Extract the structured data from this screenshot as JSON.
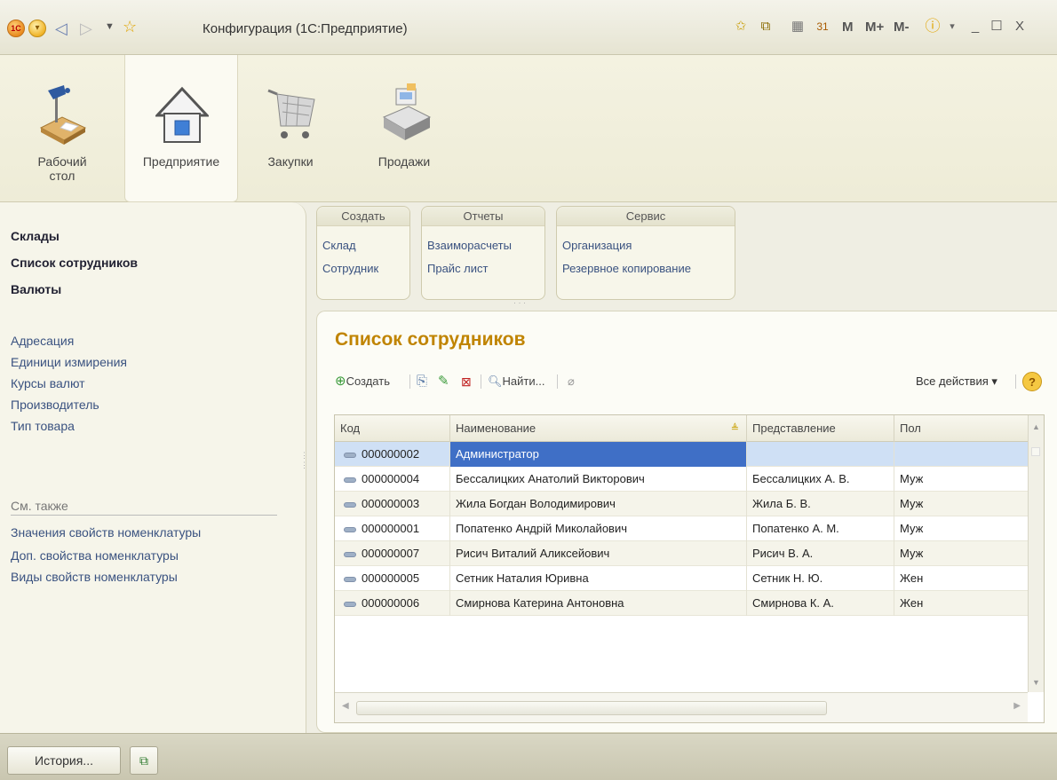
{
  "window": {
    "title": "Конфигурация  (1С:Предприятие)",
    "logo": "1C",
    "calc_buttons": [
      "M",
      "M+",
      "M-"
    ],
    "window_controls": [
      "_",
      "☐",
      "X"
    ]
  },
  "sections": [
    {
      "label_line1": "Рабочий",
      "label_line2": "стол",
      "icon": "desk-lamp-icon"
    },
    {
      "label_line1": "Предприятие",
      "label_line2": "",
      "icon": "house-icon",
      "active": true
    },
    {
      "label_line1": "Закупки",
      "label_line2": "",
      "icon": "shopping-cart-icon"
    },
    {
      "label_line1": "Продажи",
      "label_line2": "",
      "icon": "cash-register-icon"
    }
  ],
  "leftnav": {
    "main_items": [
      "Склады",
      "Список сотрудников",
      "Валюты"
    ],
    "items": [
      "Адресация",
      "Единици измирения",
      "Курсы валют",
      "Производитель",
      "Тип товара"
    ],
    "see_also_label": "См. также",
    "see_also_items": [
      "Значения свойств номенклатуры",
      "Доп. свойства номенклатуры",
      "Виды свойств номенклатуры"
    ]
  },
  "actions": {
    "create": {
      "header": "Создать",
      "items": [
        "Склад",
        "Сотрудник"
      ]
    },
    "reports": {
      "header": "Отчеты",
      "items": [
        "Взаиморасчеты",
        "Прайс лист"
      ]
    },
    "service": {
      "header": "Сервис",
      "items": [
        "Организация",
        "Резервное копирование"
      ]
    }
  },
  "form": {
    "title": "Список сотрудников",
    "toolbar": {
      "create_label": "Создать",
      "find_label": "Найти...",
      "all_actions_label": "Все действия ▾",
      "help_label": "?"
    },
    "columns": [
      "Код",
      "Наименование",
      "Представление",
      "Пол"
    ],
    "rows": [
      {
        "code": "000000002",
        "name": "Администратор",
        "short": "",
        "gender": ""
      },
      {
        "code": "000000004",
        "name": "Бессалицких Анатолий Викторович",
        "short": "Бессалицких А. В.",
        "gender": "Муж"
      },
      {
        "code": "000000003",
        "name": "Жила Богдан Володимирович",
        "short": "Жила Б. В.",
        "gender": "Муж"
      },
      {
        "code": "000000001",
        "name": "Попатенко Андрій Миколайович",
        "short": "Попатенко А. М.",
        "gender": "Муж"
      },
      {
        "code": "000000007",
        "name": "Рисич Виталий Аликсейович",
        "short": "Рисич В. А.",
        "gender": "Муж"
      },
      {
        "code": "000000005",
        "name": "Сетник Наталия Юривна",
        "short": "Сетник Н. Ю.",
        "gender": "Жен"
      },
      {
        "code": "000000006",
        "name": "Смирнова Катерина Антоновна",
        "short": "Смирнова К. А.",
        "gender": "Жен"
      }
    ]
  },
  "bottombar": {
    "history_label": "История..."
  },
  "colors": {
    "title_accent": "#c08400",
    "selection": "#3f6fc6",
    "link": "#3a5280"
  }
}
